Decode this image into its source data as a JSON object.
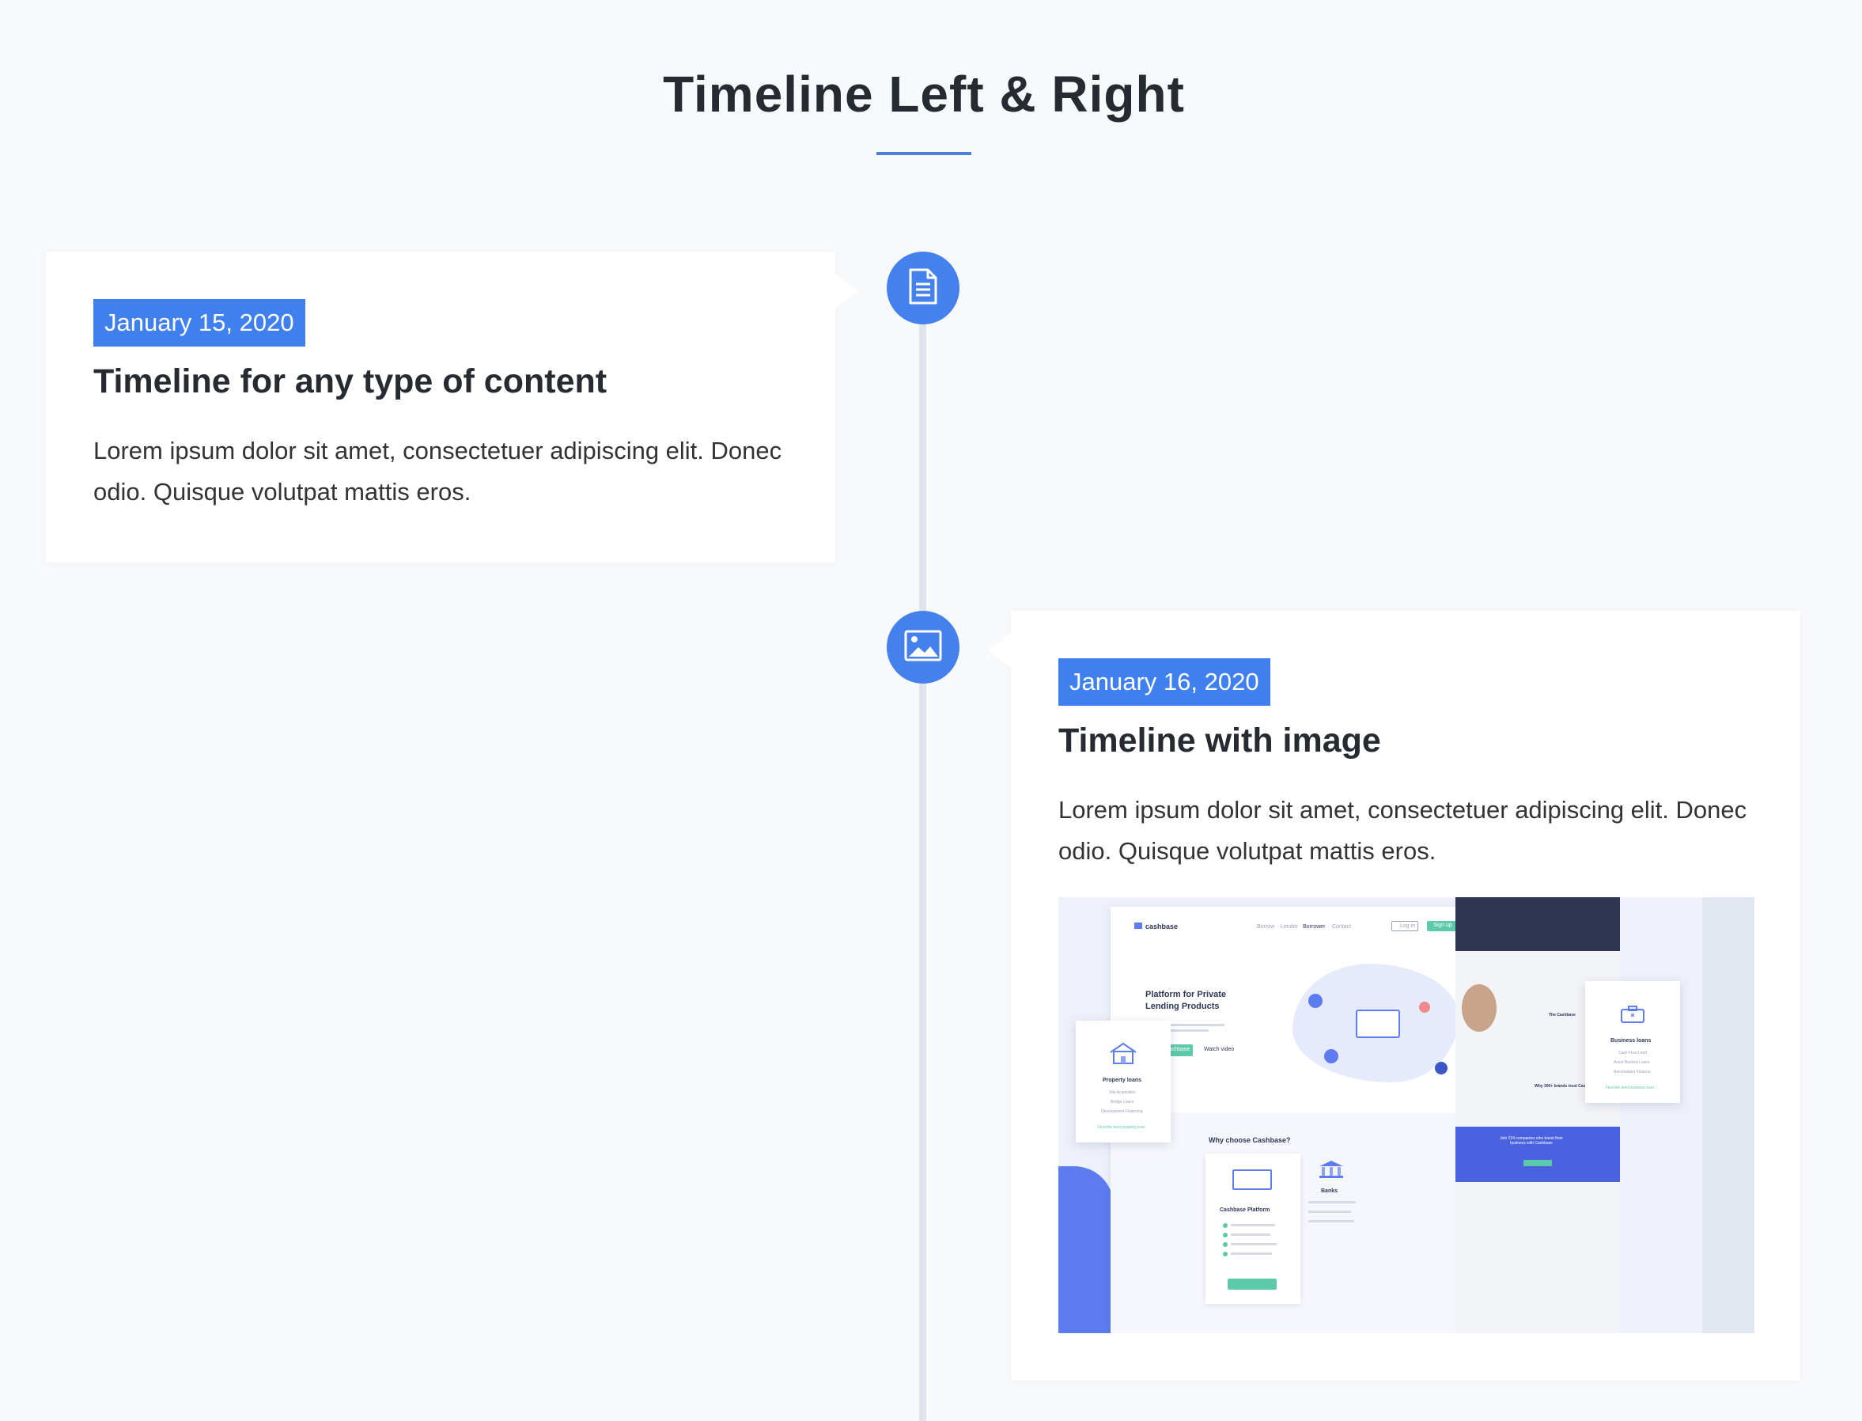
{
  "page": {
    "title": "Timeline Left & Right"
  },
  "timeline": {
    "items": [
      {
        "side": "left",
        "icon": "document-icon",
        "date": "January 15, 2020",
        "title": "Timeline for any type of content",
        "body": "Lorem ipsum dolor sit amet, consectetuer adipiscing elit. Donec odio. Quisque volutpat mattis eros."
      },
      {
        "side": "right",
        "icon": "image-icon",
        "date": "January 16, 2020",
        "title": "Timeline with image",
        "body": "Lorem ipsum dolor sit amet, consectetuer adipiscing elit. Donec odio. Quisque volutpat mattis eros.",
        "image": {
          "brand": "cashbase",
          "nav": [
            "Borrow",
            "Lender",
            "Borrower",
            "Contact"
          ],
          "login": "Log in",
          "signup": "Sign up",
          "hero_heading": "Platform for Private Lending Products",
          "cta": "Join Cashbase",
          "watch": "Watch video",
          "why": "Why choose Cashbase?",
          "property_title": "Property loans",
          "property_items": [
            "Site Acquisition",
            "Bridge Loans",
            "Development Financing"
          ],
          "property_link": "Find the best property loan",
          "platform_title": "Cashbase Platform",
          "banks_title": "Banks",
          "business_title": "Business loans",
          "business_items": [
            "Cash Flow Lend",
            "Asset Backed Loans",
            "Receivables Finance"
          ],
          "business_link": "Find the best business loan",
          "trust": "Why 300+ brands trust Cashbase",
          "join": "Join 234 companies who boost their business with Cashbase",
          "the_cashbase": "The Cashbase"
        }
      }
    ]
  },
  "colors": {
    "accent": "#3f7fee",
    "line": "#dfe4eb",
    "rule": "#4f7fd9",
    "teal": "#5ccaa8"
  }
}
